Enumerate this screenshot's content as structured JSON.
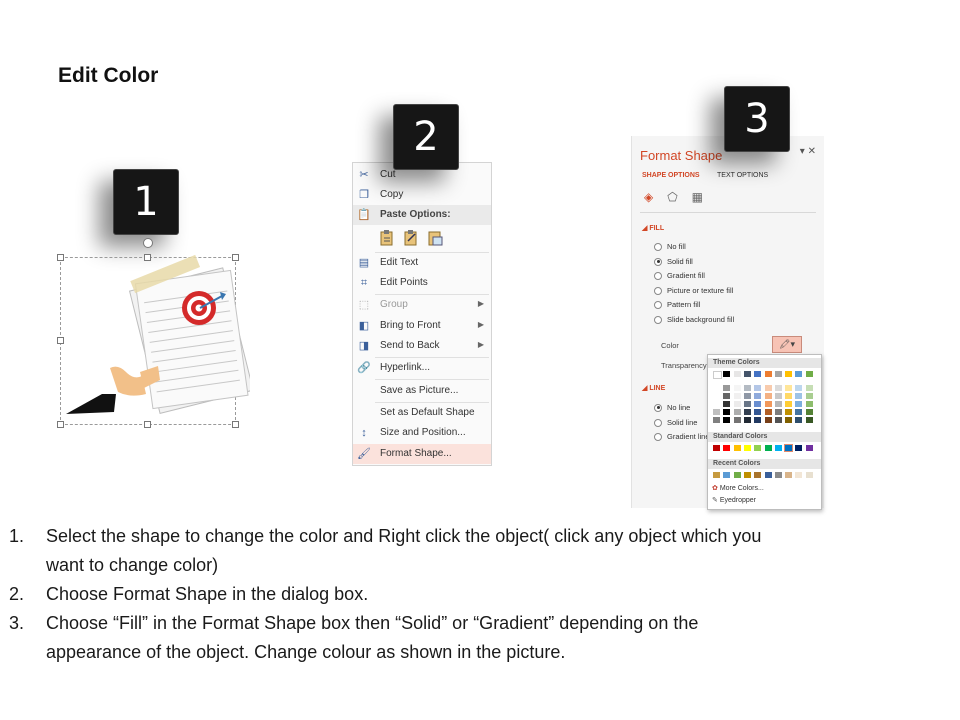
{
  "title": "Edit Color",
  "badges": [
    "1",
    "2",
    "3"
  ],
  "context_menu": {
    "items": [
      {
        "label": "Cut",
        "icon": "scissors-icon"
      },
      {
        "label": "Copy",
        "icon": "copy-icon"
      },
      {
        "label": "Paste Options:",
        "icon": "paste-icon"
      },
      {
        "label": "Edit Text",
        "icon": "edit-text-icon"
      },
      {
        "label": "Edit Points",
        "icon": "edit-points-icon"
      },
      {
        "label": "Group",
        "icon": "group-icon"
      },
      {
        "label": "Bring to Front",
        "icon": "bring-front-icon"
      },
      {
        "label": "Send to Back",
        "icon": "send-back-icon"
      },
      {
        "label": "Hyperlink...",
        "icon": "hyperlink-icon"
      },
      {
        "label": "Save as Picture...",
        "icon": ""
      },
      {
        "label": "Set as Default Shape",
        "icon": ""
      },
      {
        "label": "Size and Position...",
        "icon": "size-position-icon"
      },
      {
        "label": "Format Shape...",
        "icon": "format-shape-icon"
      }
    ]
  },
  "format_pane": {
    "title": "Format Shape",
    "tabs": [
      "SHAPE OPTIONS",
      "TEXT OPTIONS"
    ],
    "fill_section": "FILL",
    "fill_options": [
      "No fill",
      "Solid fill",
      "Gradient fill",
      "Picture or texture fill",
      "Pattern fill",
      "Slide background fill"
    ],
    "color_label": "Color",
    "transparency_label": "Transparency",
    "line_section": "LINE",
    "line_options": [
      "No line",
      "Solid line",
      "Gradient line"
    ],
    "palette": {
      "theme_colors": "Theme Colors",
      "standard_colors": "Standard Colors",
      "recent_colors": "Recent Colors",
      "more_colors": "More Colors...",
      "eyedropper": "Eyedropper"
    }
  },
  "instructions": [
    {
      "num": "1.",
      "line1": "Select the shape to change the color and Right click the object( click any object which you",
      "line2": "want to change color)"
    },
    {
      "num": "2.",
      "line1": "Choose Format Shape in the dialog box.",
      "line2": ""
    },
    {
      "num": "3.",
      "line1": "Choose “Fill” in the Format Shape box then “Solid” or “Gradient” depending on the",
      "line2": "appearance of the object. Change colour as shown in the picture."
    }
  ],
  "colors": {
    "accent": "#d24726",
    "badge": "#161616",
    "highlight": "#fbe2dc"
  }
}
